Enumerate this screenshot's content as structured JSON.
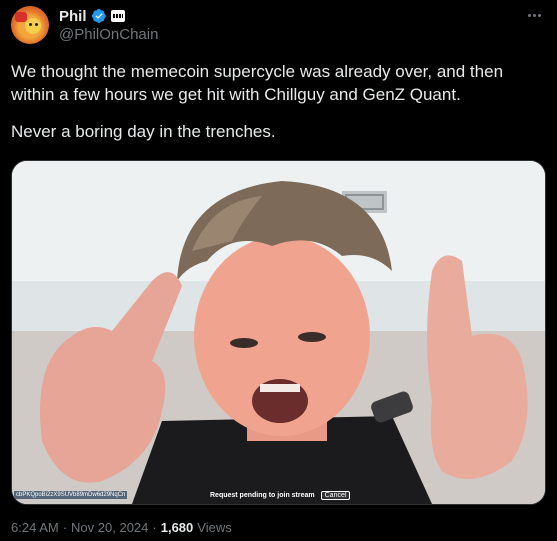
{
  "author": {
    "display_name": "Phil",
    "handle": "@PhilOnChain",
    "verified": true,
    "avatar_icon": "duck-avatar-icon"
  },
  "tweet": {
    "paragraphs": [
      "We thought the memecoin supercycle was already over, and then within a few hours we get hit with Chillguy and GenZ Quant.",
      "Never a boring day in the trenches."
    ]
  },
  "media": {
    "overlay_id": "cbPKQpoBi2zX9SUVb89mDw6d29NqCn",
    "overlay_status": "Request pending to join stream",
    "overlay_cancel": "Cancel"
  },
  "meta": {
    "time": "6:24 AM",
    "separator_1": "·",
    "date": "Nov 20, 2024",
    "separator_2": "·",
    "views_count": "1,680",
    "views_label": "Views"
  },
  "colors": {
    "background": "#000000",
    "text_primary": "#e7e9ea",
    "text_secondary": "#71767b",
    "verified_blue": "#1d9bf0"
  }
}
